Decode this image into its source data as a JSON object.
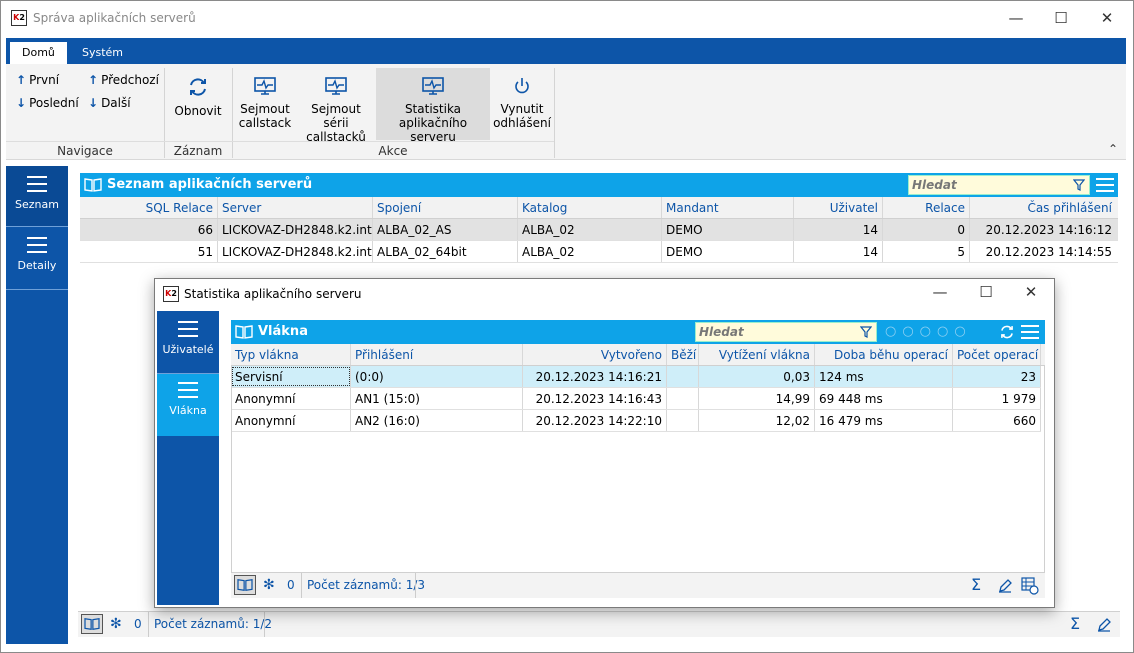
{
  "window": {
    "title": "Správa aplikačních serverů",
    "logo": "K2"
  },
  "ribbon": {
    "tabs": [
      "Domů",
      "Systém"
    ],
    "navigace": {
      "first": "První",
      "prev": "Předchozí",
      "last": "Poslední",
      "next": "Další",
      "label": "Navigace"
    },
    "zaznam": {
      "refresh": "Obnovit",
      "label": "Záznam"
    },
    "akce": {
      "btn1": [
        "Sejmout",
        "callstack"
      ],
      "btn2": [
        "Sejmout sérii",
        "callstacků"
      ],
      "btn3": [
        "Statistika",
        "aplikačního serveru"
      ],
      "btn4": [
        "Vynutit",
        "odhlášení"
      ],
      "label": "Akce"
    }
  },
  "leftnav": {
    "items": [
      "Seznam",
      "Detaily"
    ]
  },
  "main_grid": {
    "title": "Seznam aplikačních serverů",
    "search_placeholder": "Hledat",
    "columns": [
      "SQL Relace",
      "Server",
      "Spojení",
      "Katalog",
      "Mandant",
      "Uživatel",
      "Relace",
      "Čas přihlášení"
    ],
    "rows": [
      [
        "66",
        "LICKOVAZ-DH2848.k2.int",
        "ALBA_02_AS",
        "ALBA_02",
        "DEMO",
        "14",
        "0",
        "20.12.2023 14:16:12"
      ],
      [
        "51",
        "LICKOVAZ-DH2848.k2.int",
        "ALBA_02_64bit",
        "ALBA_02",
        "DEMO",
        "14",
        "5",
        "20.12.2023 14:14:55"
      ]
    ],
    "status": {
      "zero": "0",
      "count": "Počet záznamů: 1/2"
    }
  },
  "dialog": {
    "title": "Statistika aplikačního serveru",
    "nav_items": [
      "Uživatelé",
      "Vlákna"
    ],
    "grid_title": "Vlákna",
    "search_placeholder": "Hledat",
    "columns": [
      "Typ vlákna",
      "Přihlášení",
      "Vytvořeno",
      "Běží",
      "Vytížení vlákna",
      "Doba běhu operací",
      "Počet operací"
    ],
    "rows": [
      [
        "Servisní",
        " (0:0)",
        "20.12.2023 14:16:21",
        "",
        "0,03",
        "124 ms",
        "23"
      ],
      [
        "Anonymní",
        "AN1 (15:0)",
        "20.12.2023 14:16:43",
        "",
        "14,99",
        "69 448 ms",
        "1 979"
      ],
      [
        "Anonymní",
        "AN2 (16:0)",
        "20.12.2023 14:22:10",
        "",
        "12,02",
        "16 479 ms",
        "660"
      ]
    ],
    "status": {
      "zero": "0",
      "count": "Počet záznamů: 1/3"
    }
  },
  "icons": {
    "sigma": "Σ",
    "edit": "pencil-icon",
    "filter": "funnel-icon",
    "menu": "hamburger-icon",
    "book": "book-icon",
    "snowflake": "✻"
  },
  "colors": {
    "ribbon_blue": "#0d55a8",
    "panel_cyan": "#0ea3e8",
    "search_bg": "#fffbdb"
  }
}
